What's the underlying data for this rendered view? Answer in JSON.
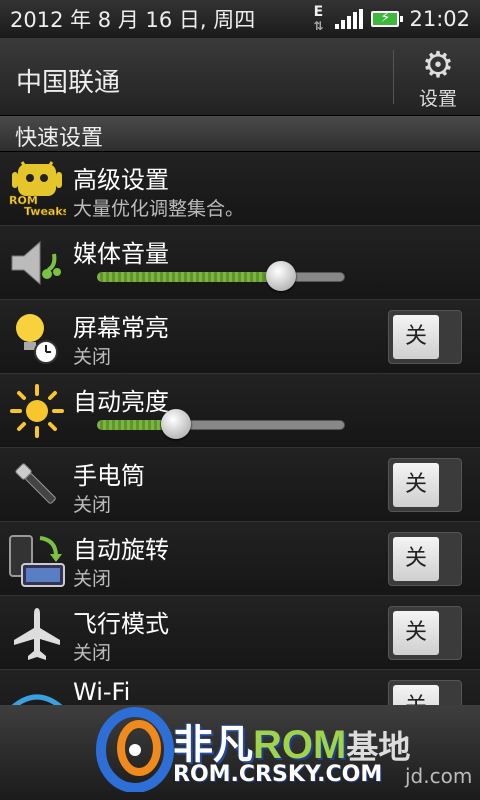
{
  "status_bar": {
    "date": "2012 年 8 月 16 日, 周四",
    "network_type": "E",
    "time": "21:02"
  },
  "header": {
    "carrier": "中国联通",
    "settings_label": "设置"
  },
  "section": {
    "title": "快速设置"
  },
  "rows": [
    {
      "title": "高级设置",
      "sub": "大量优化调整集合。"
    },
    {
      "title": "媒体音量",
      "level": 0.74
    },
    {
      "title": "屏幕常亮",
      "sub": "关闭",
      "toggle": "关"
    },
    {
      "title": "自动亮度",
      "level": 0.32
    },
    {
      "title": "手电筒",
      "sub": "关闭",
      "toggle": "关"
    },
    {
      "title": "自动旋转",
      "sub": "关闭",
      "toggle": "关"
    },
    {
      "title": "飞行模式",
      "sub": "关闭",
      "toggle": "关"
    },
    {
      "title": "Wi-Fi",
      "toggle": "关"
    }
  ],
  "icons": {
    "tweaks": "android-tweaks-icon",
    "volume": "speaker-icon",
    "screen": "lightbulb-clock-icon",
    "brightness": "sun-icon",
    "flashlight": "flashlight-icon",
    "rotate": "rotate-phone-icon",
    "airplane": "airplane-icon",
    "wifi": "wifi-icon"
  },
  "watermark": {
    "brand_a": "非凡",
    "brand_b": "ROM",
    "brand_c": "基地",
    "url": "ROM.CRSKY.COM",
    "url_partial": "jd.com"
  },
  "colors": {
    "slider_fill": "#7cb342",
    "watermark_green": "#9fd34a",
    "watermark_blue": "#234a9c"
  }
}
